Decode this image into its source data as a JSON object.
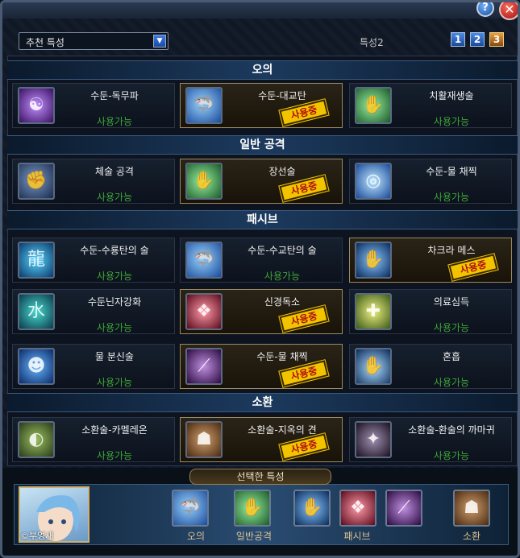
{
  "header": {
    "dropdown_value": "추천 특성",
    "slot_label": "특성2",
    "pages": [
      "1",
      "2",
      "3"
    ]
  },
  "categories": {
    "ougi": "오의",
    "normal": "일반 공격",
    "passive": "패시브",
    "summon": "소환"
  },
  "skills": [
    {
      "name": "수둔-독무파",
      "status": "사용가능",
      "active": false,
      "icon": "purple-poison-icon"
    },
    {
      "name": "수둔-대교탄",
      "status": "사용중",
      "active": true,
      "icon": "water-shark-icon"
    },
    {
      "name": "치활재생술",
      "status": "사용가능",
      "active": false,
      "icon": "green-heal-hand-icon"
    },
    {
      "name": "체술 공격",
      "status": "사용가능",
      "active": false,
      "icon": "fist-icon"
    },
    {
      "name": "장선술",
      "status": "사용중",
      "active": true,
      "icon": "green-palm-icon"
    },
    {
      "name": "수둔-물 채찍",
      "status": "사용가능",
      "active": false,
      "icon": "water-whip-icon"
    },
    {
      "name": "수둔-수룡탄의 술",
      "status": "사용가능",
      "active": false,
      "icon": "water-dragon-icon"
    },
    {
      "name": "수둔-수교탄의 술",
      "status": "사용가능",
      "active": false,
      "icon": "water-shark-icon"
    },
    {
      "name": "차크라 메스",
      "status": "사용중",
      "active": true,
      "icon": "chakra-scalpel-icon"
    },
    {
      "name": "수둔닌자강화",
      "status": "사용가능",
      "active": false,
      "icon": "water-kanji-icon"
    },
    {
      "name": "신경독소",
      "status": "사용중",
      "active": true,
      "icon": "brain-icon"
    },
    {
      "name": "의료심득",
      "status": "사용가능",
      "active": false,
      "icon": "medical-scroll-icon"
    },
    {
      "name": "물 분신술",
      "status": "사용가능",
      "active": false,
      "icon": "water-clone-icon"
    },
    {
      "name": "수둔-물 채찍",
      "status": "사용중",
      "active": true,
      "icon": "purple-blade-icon"
    },
    {
      "name": "혼흡",
      "status": "사용가능",
      "active": false,
      "icon": "glowing-palm-icon"
    },
    {
      "name": "소환술-카멜레온",
      "status": "사용가능",
      "active": false,
      "icon": "chameleon-icon"
    },
    {
      "name": "소환술-지옥의 견",
      "status": "사용중",
      "active": true,
      "icon": "hell-hound-icon"
    },
    {
      "name": "소환술-환술의 까마귀",
      "status": "사용가능",
      "active": false,
      "icon": "crow-icon"
    }
  ],
  "selected": {
    "title": "선택한 특성",
    "player_name": "©부엉새",
    "labels": [
      "오의",
      "일반공격",
      "패시브",
      "소환"
    ]
  }
}
